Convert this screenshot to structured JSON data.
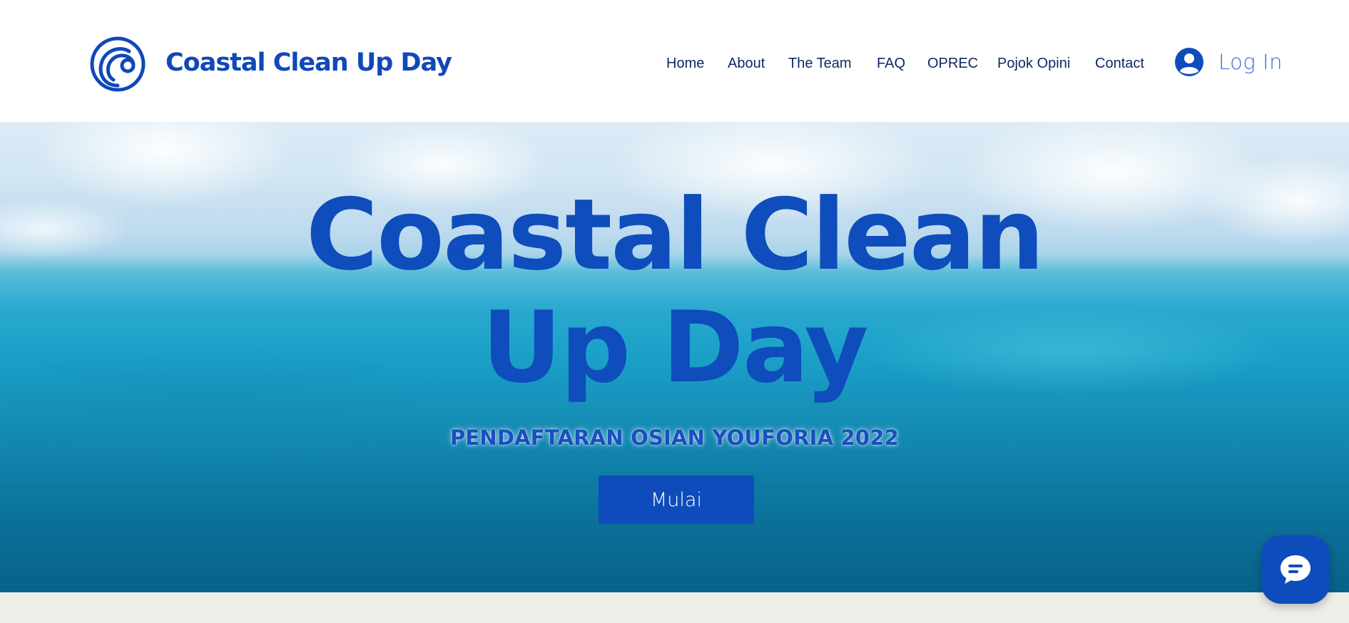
{
  "header": {
    "logo_icon": "wave-circle-logo-icon",
    "site_title": "Coastal Clean Up Day",
    "nav": [
      {
        "label": "Home"
      },
      {
        "label": "About"
      },
      {
        "label": "The Team"
      },
      {
        "label": "FAQ"
      },
      {
        "label": "OPREC"
      },
      {
        "label": "Pojok Opini"
      },
      {
        "label": "Contact"
      }
    ],
    "login": {
      "icon": "user-avatar-icon",
      "label": "Log In"
    }
  },
  "hero": {
    "title_line1": "Coastal Clean",
    "title_line2": "Up Day",
    "subtitle": "PENDAFTARAN OSIAN YOUFORIA 2022",
    "cta_label": "Mulai"
  },
  "chat_widget": {
    "icon": "chat-bubble-icon"
  },
  "colors": {
    "brand_blue": "#0f4cbb",
    "nav_text": "#0e2a63",
    "footer_band": "#eeeee8"
  }
}
